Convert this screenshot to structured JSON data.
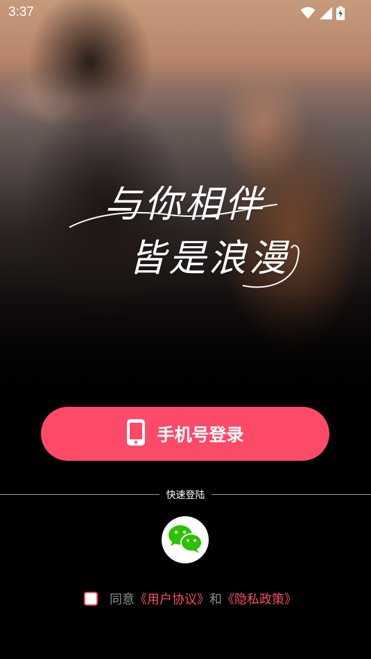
{
  "status_bar": {
    "time": "3:37",
    "icons": [
      "wifi-icon",
      "signal-icon",
      "battery-charging-icon"
    ]
  },
  "slogan": {
    "line1": "与你相伴",
    "line2": "皆是浪漫"
  },
  "login": {
    "phone_button_label": "手机号登录",
    "phone_icon": "mobile-phone-icon"
  },
  "quick_login": {
    "label": "快速登陆",
    "wechat_icon": "wechat-icon"
  },
  "agreement": {
    "prefix": "同意",
    "user_agreement": "《用户协议》",
    "conjunction": "和",
    "privacy_policy": "《隐私政策》",
    "checked": false
  },
  "colors": {
    "accent": "#fd4a69",
    "wechat_green": "#2dc100",
    "muted_text": "#8e8e8e",
    "background": "#000000"
  }
}
